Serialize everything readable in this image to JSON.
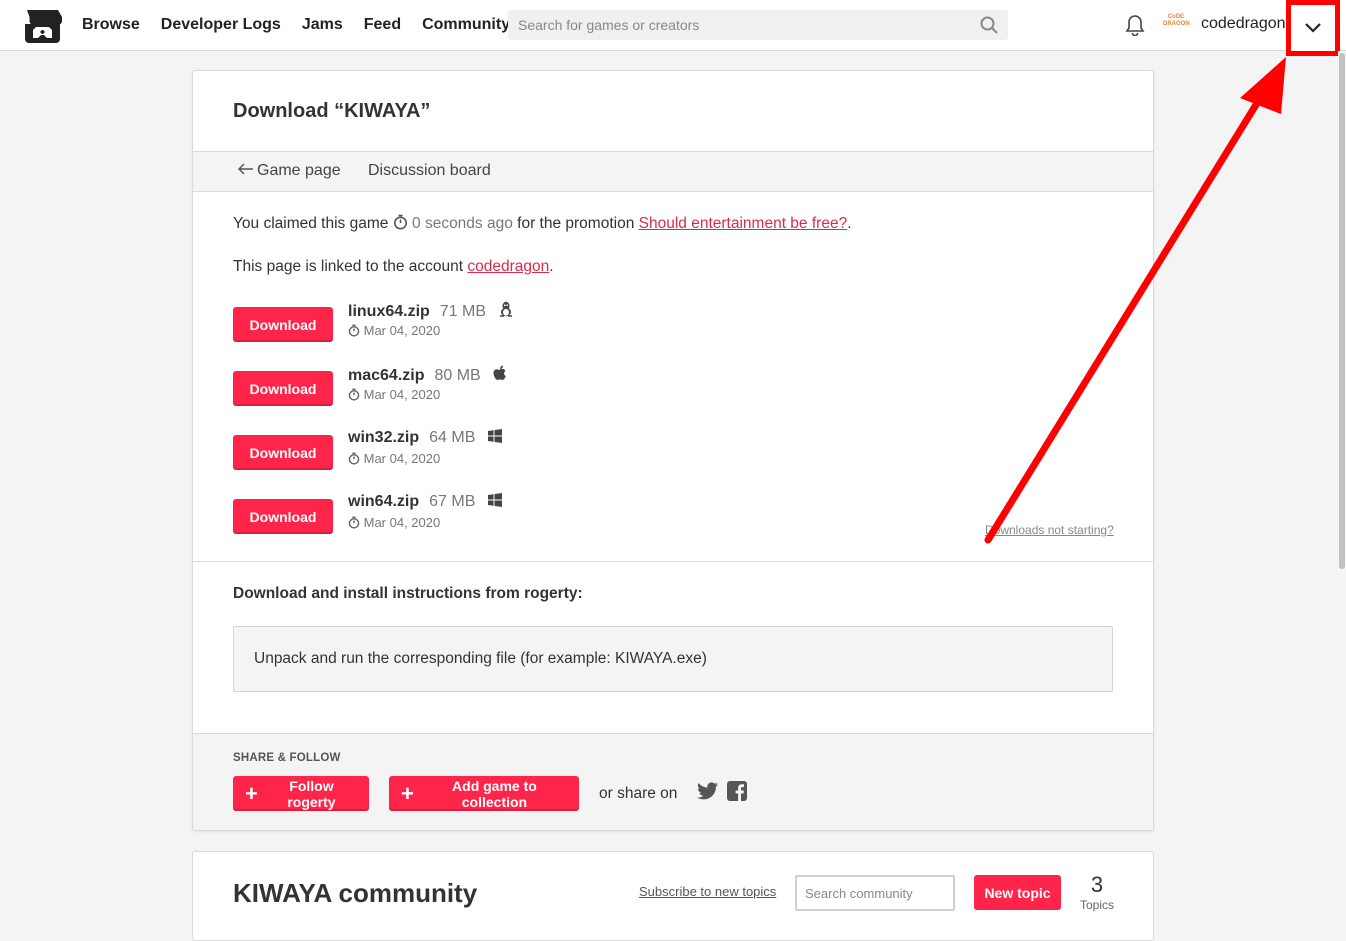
{
  "header": {
    "nav": [
      "Browse",
      "Developer Logs",
      "Jams",
      "Feed",
      "Community"
    ],
    "search_placeholder": "Search for games or creators",
    "username": "codedragon",
    "avatar_text": "CoDE DRAGON"
  },
  "page": {
    "title": "Download “KIWAYA”",
    "tabs": {
      "game_page": "Game page",
      "discussion": "Discussion board"
    },
    "claim": {
      "prefix": "You claimed this game",
      "time": "0 seconds ago",
      "middle": "for the promotion",
      "promo": "Should entertainment be free?",
      "suffix": "."
    },
    "account": {
      "prefix": "This page is linked to the account",
      "name": "codedragon",
      "suffix": "."
    },
    "downloads": [
      {
        "button": "Download",
        "file": "linux64.zip",
        "size": "71 MB",
        "os": "linux-icon",
        "date": "Mar 04, 2020"
      },
      {
        "button": "Download",
        "file": "mac64.zip",
        "size": "80 MB",
        "os": "apple-icon",
        "date": "Mar 04, 2020"
      },
      {
        "button": "Download",
        "file": "win32.zip",
        "size": "64 MB",
        "os": "windows-icon",
        "date": "Mar 04, 2020"
      },
      {
        "button": "Download",
        "file": "win64.zip",
        "size": "67 MB",
        "os": "windows-icon",
        "date": "Mar 04, 2020"
      }
    ],
    "not_starting": "Downloads not starting?",
    "instructions_title": "Download and install instructions from rogerty:",
    "instructions_text": "Unpack and run the corresponding file (for example: KIWAYA.exe)",
    "share": {
      "label": "SHARE & FOLLOW",
      "follow": "Follow rogerty",
      "collection": "Add game to collection",
      "or_share": "or share on"
    }
  },
  "community": {
    "title": "KIWAYA community",
    "subscribe": "Subscribe to new topics",
    "search_placeholder": "Search community",
    "new_topic": "New topic",
    "topics_count": "3",
    "topics_label": "Topics"
  },
  "colors": {
    "accent": "#ff2449",
    "link": "#da2c49",
    "annotation": "#ff0000"
  }
}
